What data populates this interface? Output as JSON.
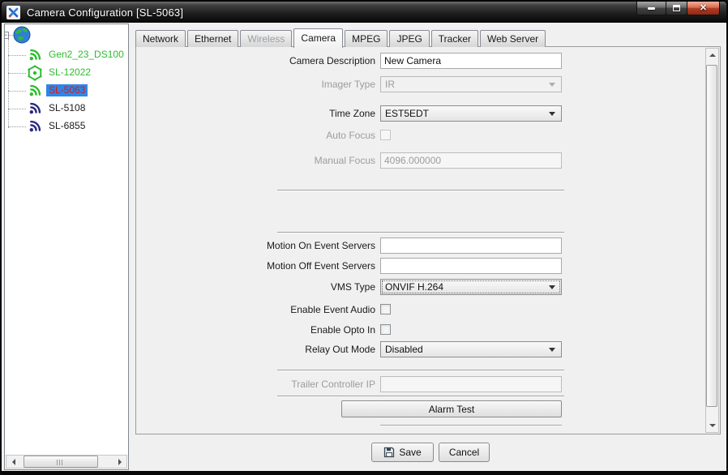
{
  "window": {
    "title": "Camera Configuration [SL-5063]"
  },
  "icons": {
    "app": "blue-x-logo",
    "minimize": "minimize-bar",
    "restore": "restore-squares",
    "close": "✕",
    "tree_collapse": "−",
    "root": "globe",
    "wifi": "wifi-signal-arcs",
    "mesh": "hexagon-node",
    "dropdown_arrow": "▼",
    "save": "floppy-disk",
    "scroll_up": "▲",
    "scroll_down": "▼",
    "scroll_left": "◄",
    "scroll_right": "►"
  },
  "tree": {
    "root": {
      "icon": "globe",
      "expanded": true
    },
    "items": [
      {
        "label": "Gen2_23_DS100",
        "icon": "wifi-signal-icon",
        "status_color": "#2dbd2d",
        "selected": false
      },
      {
        "label": "SL-12022",
        "icon": "hexagon-node-icon",
        "status_color": "#2dbd2d",
        "selected": false
      },
      {
        "label": "SL-5063",
        "icon": "wifi-signal-icon",
        "status_color": "#2dbd2d",
        "selected": true
      },
      {
        "label": "SL-5108",
        "icon": "wifi-signal-icon",
        "status_color": "#29297e",
        "selected": false
      },
      {
        "label": "SL-6855",
        "icon": "wifi-signal-icon",
        "status_color": "#29297e",
        "selected": false
      }
    ]
  },
  "tabs": [
    {
      "label": "Network",
      "state": "normal"
    },
    {
      "label": "Ethernet",
      "state": "normal"
    },
    {
      "label": "Wireless",
      "state": "disabled"
    },
    {
      "label": "Camera",
      "state": "active"
    },
    {
      "label": "MPEG",
      "state": "normal"
    },
    {
      "label": "JPEG",
      "state": "normal"
    },
    {
      "label": "Tracker",
      "state": "normal"
    },
    {
      "label": "Web Server",
      "state": "normal"
    }
  ],
  "form": {
    "camera_description": {
      "label": "Camera Description",
      "value": "New Camera",
      "enabled": true
    },
    "imager_type": {
      "label": "Imager Type",
      "value": "IR",
      "enabled": false
    },
    "time_zone": {
      "label": "Time Zone",
      "value": "EST5EDT",
      "enabled": true
    },
    "auto_focus": {
      "label": "Auto Focus",
      "checked": false,
      "enabled": false
    },
    "manual_focus": {
      "label": "Manual Focus",
      "value": "4096.000000",
      "enabled": false
    },
    "motion_on_event_servers": {
      "label": "Motion On Event Servers",
      "value": "",
      "enabled": true
    },
    "motion_off_event_servers": {
      "label": "Motion Off Event Servers",
      "value": "",
      "enabled": true
    },
    "vms_type": {
      "label": "VMS Type",
      "value": "ONVIF H.264",
      "enabled": true,
      "focused": true
    },
    "enable_event_audio": {
      "label": "Enable Event Audio",
      "checked": false,
      "enabled": true
    },
    "enable_opto_in": {
      "label": "Enable Opto In",
      "checked": false,
      "enabled": true
    },
    "relay_out_mode": {
      "label": "Relay Out Mode",
      "value": "Disabled",
      "enabled": true
    },
    "trailer_controller_ip": {
      "label": "Trailer Controller IP",
      "value": "",
      "enabled": false
    },
    "alarm_test_button": {
      "label": "Alarm Test"
    }
  },
  "footer": {
    "save_label": "Save",
    "cancel_label": "Cancel"
  },
  "colors": {
    "selection_bg": "#2e86e8",
    "selected_item_text": "#cf1d1d",
    "online_green": "#2dbd2d",
    "offline_navy": "#29297e",
    "close_button_red": "#b33c24",
    "panel_bg": "#f0f0f0"
  }
}
